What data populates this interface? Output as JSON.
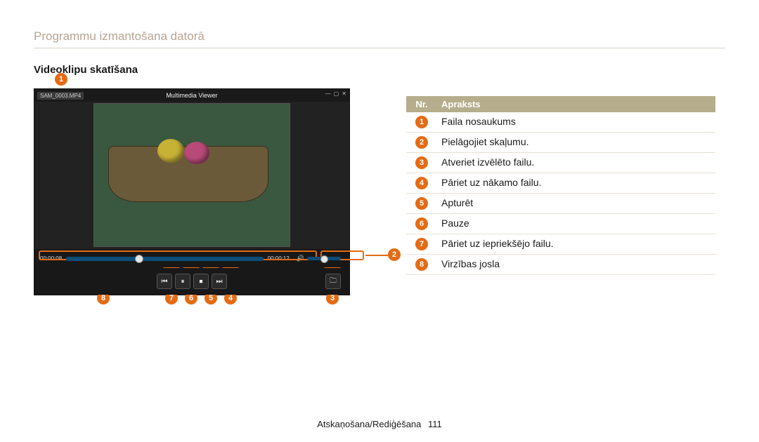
{
  "section_title": "Programmu izmantošana datorā",
  "sub_title": "Videoklipu skatīšana",
  "viewer": {
    "file_label": "SAM_0003.MP4",
    "window_title": "Multimedia Viewer",
    "time_current": "00:00:08",
    "time_total": "00:00:12"
  },
  "legend": {
    "header_nr": "Nr.",
    "header_desc": "Apraksts",
    "rows": [
      {
        "n": "1",
        "desc": "Faila nosaukums"
      },
      {
        "n": "2",
        "desc": "Pielāgojiet skaļumu."
      },
      {
        "n": "3",
        "desc": "Atveriet izvēlēto failu."
      },
      {
        "n": "4",
        "desc": "Pāriet uz nākamo failu."
      },
      {
        "n": "5",
        "desc": "Apturēt"
      },
      {
        "n": "6",
        "desc": "Pauze"
      },
      {
        "n": "7",
        "desc": "Pāriet uz iepriekšējo failu."
      },
      {
        "n": "8",
        "desc": "Virzības josla"
      }
    ]
  },
  "callouts": {
    "c1": "1",
    "c2": "2",
    "c3": "3",
    "c4": "4",
    "c5": "5",
    "c6": "6",
    "c7": "7",
    "c8": "8"
  },
  "footer": {
    "chapter": "Atskaņošana/Rediģēšana",
    "page": "111"
  }
}
